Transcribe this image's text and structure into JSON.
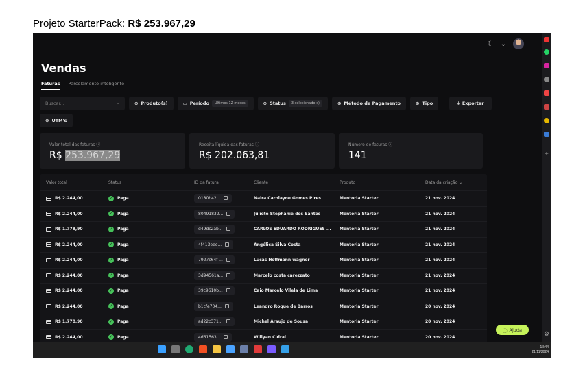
{
  "caption": {
    "prefix": "Projeto StarterPack:",
    "amount": "R$ 253.967,29"
  },
  "page": {
    "title": "Vendas"
  },
  "tabs": [
    {
      "label": "Faturas"
    },
    {
      "label": "Parcelamento inteligente"
    }
  ],
  "filters": {
    "search_placeholder": "Buscar...",
    "produto": "Produto(s)",
    "periodo": "Período",
    "periodo_value": "Últimos 12 meses",
    "status": "Status",
    "status_value": "3 selecionado(s)",
    "pagamento": "Método de Pagamento",
    "tipo": "Tipo",
    "exportar": "Exportar",
    "utm": "UTM's"
  },
  "cards": [
    {
      "label": "Valor total das faturas ⓘ",
      "value_prefix": "R$ ",
      "value": "253.967,29"
    },
    {
      "label": "Receita líquida das faturas ⓘ",
      "value": "R$ 202.063,81"
    },
    {
      "label": "Número de faturas ⓘ",
      "value": "141"
    }
  ],
  "table": {
    "headers": [
      "Valor total",
      "Status",
      "ID da fatura",
      "Cliente",
      "Produto",
      "Data da criação ⌄"
    ],
    "rows": [
      {
        "valor": "R$ 2.244,00",
        "status": "Paga",
        "id": "0180b42...",
        "cliente": "Naira Carolayne Gomes Pires",
        "produto": "Mentoria Starter",
        "data": "21 nov. 2024"
      },
      {
        "valor": "R$ 2.244,00",
        "status": "Paga",
        "id": "80491832...",
        "cliente": "Juliete Stephanie dos Santos",
        "produto": "Mentoria Starter",
        "data": "21 nov. 2024"
      },
      {
        "valor": "R$ 1.778,90",
        "status": "Paga",
        "id": "d49dc2ab...",
        "cliente": "CARLOS EDUARDO RODRIGUES ...",
        "produto": "Mentoria Starter",
        "data": "21 nov. 2024"
      },
      {
        "valor": "R$ 2.244,00",
        "status": "Paga",
        "id": "4f413eee...",
        "cliente": "Angélica Silva Costa",
        "produto": "Mentoria Starter",
        "data": "21 nov. 2024"
      },
      {
        "valor": "R$ 2.244,00",
        "status": "Paga",
        "id": "7927c64f-...",
        "cliente": "Lucas Hoffmann wagner",
        "produto": "Mentoria Starter",
        "data": "21 nov. 2024"
      },
      {
        "valor": "R$ 2.244,00",
        "status": "Paga",
        "id": "3d94561a...",
        "cliente": "Marcelo costa carezzato",
        "produto": "Mentoria Starter",
        "data": "21 nov. 2024"
      },
      {
        "valor": "R$ 2.244,00",
        "status": "Paga",
        "id": "39c9610b...",
        "cliente": "Caio Marcelo Vilela de Lima",
        "produto": "Mentoria Starter",
        "data": "21 nov. 2024"
      },
      {
        "valor": "R$ 2.244,00",
        "status": "Paga",
        "id": "b1cfe704...",
        "cliente": "Leandro Roque de Barros",
        "produto": "Mentoria Starter",
        "data": "20 nov. 2024"
      },
      {
        "valor": "R$ 1.778,90",
        "status": "Paga",
        "id": "ad22c371...",
        "cliente": "Michel Araujo de Sousa",
        "produto": "Mentoria Starter",
        "data": "20 nov. 2024"
      },
      {
        "valor": "R$ 2.244,00",
        "status": "Paga",
        "id": "4d61563...",
        "cliente": "Willyan Cidral",
        "produto": "Mentoria Starter",
        "data": "20 nov. 2024"
      }
    ]
  },
  "help": {
    "label": "Ajuda"
  },
  "clock": {
    "time": "18:44",
    "date": "21/11/2024"
  },
  "colors": {
    "background": "#0e0e10",
    "panel": "#1a1a1d",
    "paid_green": "#46c15a",
    "help_bg": "#c6f25a"
  }
}
